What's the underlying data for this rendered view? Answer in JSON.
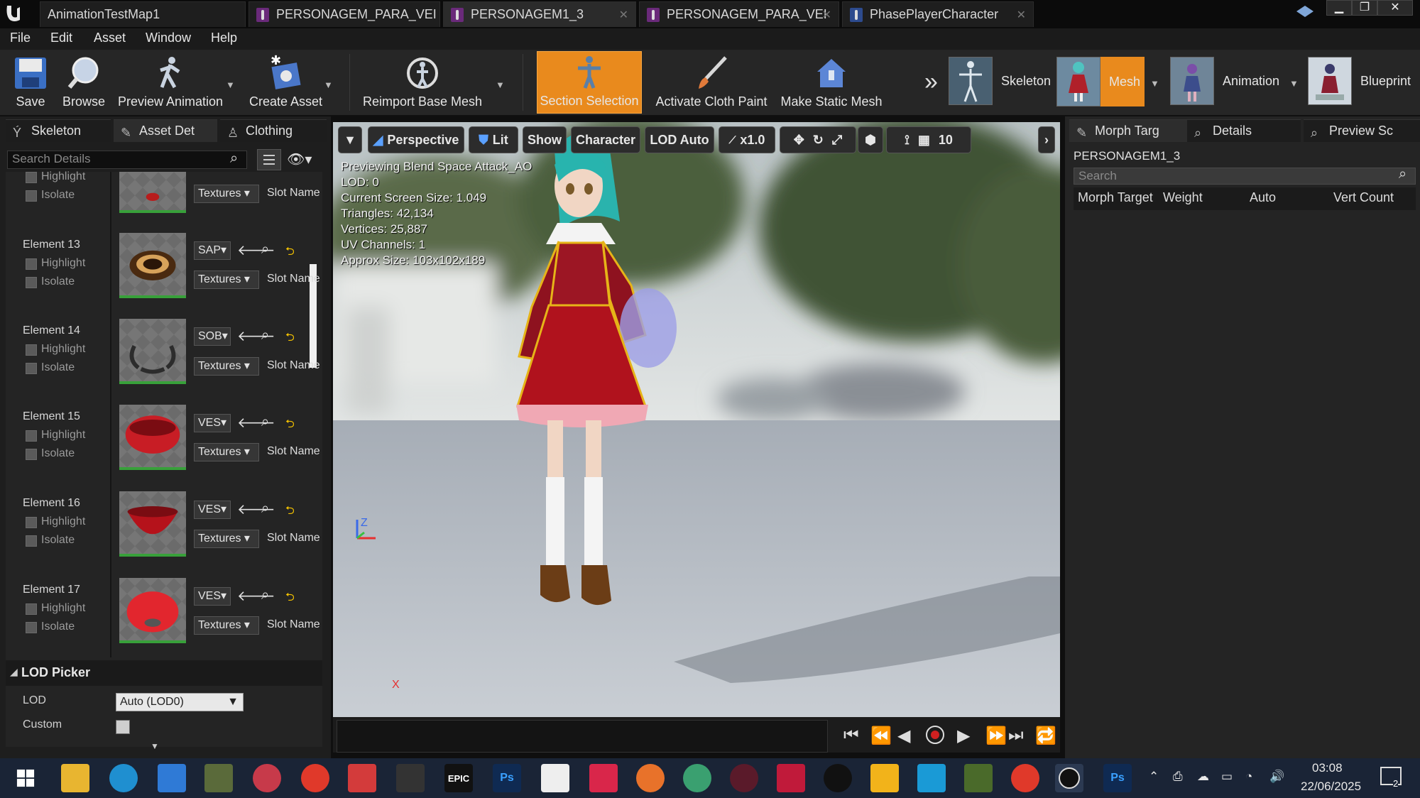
{
  "window": {
    "tabs": [
      {
        "label": "AnimationTestMap1",
        "active": false
      },
      {
        "label": "PERSONAGEM_PARA_VEI",
        "active": false
      },
      {
        "label": "PERSONAGEM1_3",
        "active": true
      },
      {
        "label": "PERSONAGEM_PARA_VEI",
        "active": false
      },
      {
        "label": "PhasePlayerCharacter",
        "active": false
      }
    ],
    "controls": {
      "minimize": "▁",
      "restore": "❐",
      "close": "✕"
    }
  },
  "menu": [
    "File",
    "Edit",
    "Asset",
    "Window",
    "Help"
  ],
  "toolbar": {
    "save": "Save",
    "browse": "Browse",
    "preview_animation": "Preview Animation",
    "create_asset": "Create Asset",
    "reimport": "Reimport Base Mesh",
    "section_selection": "Section Selection",
    "cloth_paint": "Activate Cloth Paint",
    "make_static": "Make Static Mesh",
    "more": "»",
    "modes": {
      "skeleton": "Skeleton",
      "mesh": "Mesh",
      "animation": "Animation",
      "blueprint": "Blueprint"
    },
    "accent": "#e98a1d"
  },
  "left_panel": {
    "tabs": [
      "Skeleton",
      "Asset Det",
      "Clothing"
    ],
    "search_placeholder": "Search Details",
    "top_partial": {
      "highlight": "Highlight",
      "isolate": "Isolate",
      "textures": "Textures",
      "slot": "Slot Name"
    },
    "elements": [
      {
        "name": "Element 13",
        "highlight": "Highlight",
        "isolate": "Isolate",
        "material": "SAP",
        "textures": "Textures",
        "slot": "Slot Name"
      },
      {
        "name": "Element 14",
        "highlight": "Highlight",
        "isolate": "Isolate",
        "material": "SOB",
        "textures": "Textures",
        "slot": "Slot Name"
      },
      {
        "name": "Element 15",
        "highlight": "Highlight",
        "isolate": "Isolate",
        "material": "VES",
        "textures": "Textures",
        "slot": "Slot Name"
      },
      {
        "name": "Element 16",
        "highlight": "Highlight",
        "isolate": "Isolate",
        "material": "VES",
        "textures": "Textures",
        "slot": "Slot Name"
      },
      {
        "name": "Element 17",
        "highlight": "Highlight",
        "isolate": "Isolate",
        "material": "VES",
        "textures": "Textures",
        "slot": "Slot Name"
      }
    ],
    "lod_picker": {
      "title": "LOD Picker",
      "lod_label": "LOD",
      "lod_value": "Auto (LOD0)",
      "custom_label": "Custom"
    }
  },
  "viewport": {
    "buttons": {
      "perspective": "Perspective",
      "lit": "Lit",
      "show": "Show",
      "character": "Character",
      "lod": "LOD Auto",
      "speed": "x1.0",
      "grid": "10"
    },
    "stats": [
      "Previewing Blend Space Attack_AO",
      "LOD: 0",
      "Current Screen Size: 1.049",
      "Triangles: 42,134",
      "Vertices: 25,887",
      "UV Channels: 1",
      "Approx Size: 103x102x189"
    ],
    "axis": {
      "z": "Z",
      "x": "X"
    }
  },
  "right_panel": {
    "tabs": [
      "Morph Targ",
      "Details",
      "Preview Sc"
    ],
    "asset_name": "PERSONAGEM1_3",
    "search_placeholder": "Search",
    "columns": [
      "Morph Target",
      "Weight",
      "Auto",
      "Vert Count"
    ]
  },
  "taskbar": {
    "icons": [
      "windows-start",
      "file-explorer",
      "edge",
      "mail",
      "app-blue",
      "app-red",
      "chrome",
      "mega-app",
      "bird-app",
      "epic-games",
      "photoshop",
      "zbrush",
      "marvelous",
      "blender",
      "substance",
      "app-heart",
      "app-heart2",
      "unreal-engine",
      "ms-store",
      "clip-app",
      "app-green",
      "chrome-profile",
      "unreal-engine-active",
      "photoshop-active"
    ],
    "epic_label": "EPIC",
    "ps_label": "Ps",
    "time": "03:08",
    "date": "22/06/2025",
    "notifications": "2"
  }
}
